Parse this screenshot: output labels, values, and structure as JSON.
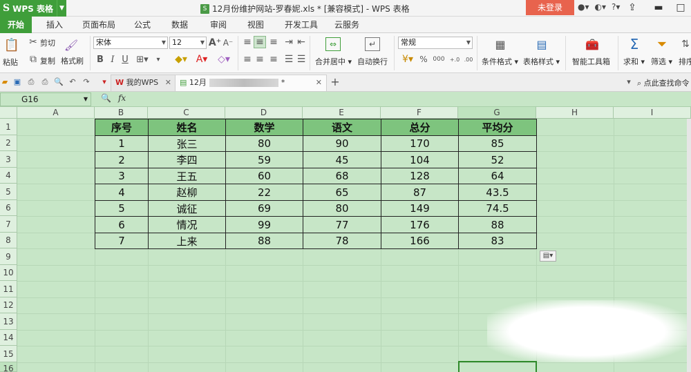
{
  "titlebar": {
    "app_name": "WPS 表格",
    "app_logo": "S",
    "window_title": "12月份维护网站-罗春妮.xls * [兼容模式] - WPS 表格",
    "login_label": "未登录",
    "help_icon": "?"
  },
  "menu": {
    "tabs": [
      "开始",
      "插入",
      "页面布局",
      "公式",
      "数据",
      "审阅",
      "视图",
      "开发工具",
      "云服务"
    ]
  },
  "ribbon": {
    "paste_label": "粘贴",
    "cut_label": "剪切",
    "copy_label": "复制",
    "format_painter_label": "格式刷",
    "font_name": "宋体",
    "font_size": "12",
    "bold": "B",
    "italic": "I",
    "underline": "U",
    "merge_center_label": "合并居中",
    "wrap_text_label": "自动换行",
    "number_format": "常规",
    "percent": "%",
    "thousands": "000",
    "conditional_format_label": "条件格式",
    "table_style_label": "表格样式",
    "smart_toolbox_label": "智能工具箱",
    "sum_label": "求和",
    "filter_label": "筛选",
    "sort_label": "排序"
  },
  "docbar": {
    "my_wps_tab": "我的WPS",
    "file_tab_prefix": "12月",
    "file_tab_suffix": "*",
    "add_tab": "+",
    "search_placeholder": "点此查找命令"
  },
  "formula_bar": {
    "name_box": "G16",
    "fx_label": "fx",
    "formula": ""
  },
  "sheet": {
    "columns": [
      "A",
      "B",
      "C",
      "D",
      "E",
      "F",
      "G",
      "H",
      "I"
    ],
    "rows": [
      "1",
      "2",
      "3",
      "4",
      "5",
      "6",
      "7",
      "8",
      "9",
      "10",
      "11",
      "12",
      "13",
      "14",
      "15",
      "16"
    ],
    "selected_cell": "G16",
    "table_headers": [
      "序号",
      "姓名",
      "数学",
      "语文",
      "总分",
      "平均分"
    ],
    "table_rows": [
      [
        "1",
        "张三",
        "80",
        "90",
        "170",
        "85"
      ],
      [
        "2",
        "李四",
        "59",
        "45",
        "104",
        "52"
      ],
      [
        "3",
        "王五",
        "60",
        "68",
        "128",
        "64"
      ],
      [
        "4",
        "赵柳",
        "22",
        "65",
        "87",
        "43.5"
      ],
      [
        "5",
        "诚征",
        "69",
        "80",
        "149",
        "74.5"
      ],
      [
        "6",
        "情况",
        "99",
        "77",
        "176",
        "88"
      ],
      [
        "7",
        "上来",
        "88",
        "78",
        "166",
        "83"
      ]
    ]
  },
  "colors": {
    "accent": "#3f9e3a",
    "sheet_bg": "#c7e6c7",
    "table_header_bg": "#7ec47e",
    "login_bg": "#e8634d"
  }
}
